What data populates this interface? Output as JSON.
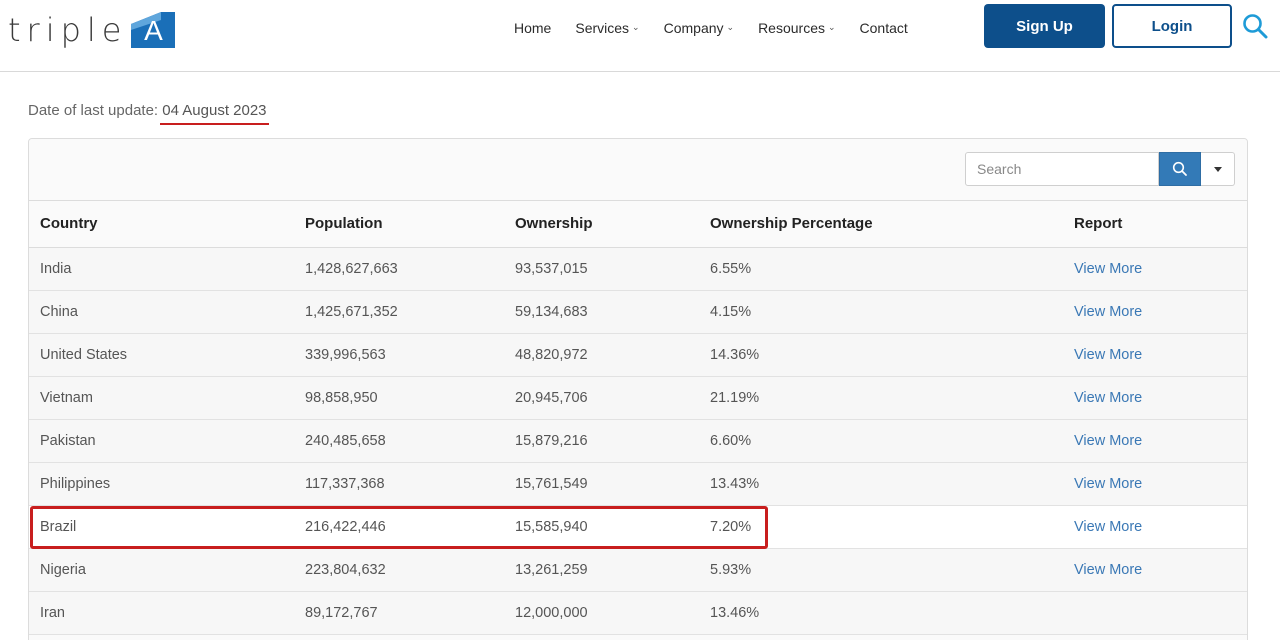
{
  "brand": {
    "logo_text": "triple",
    "logo_letter": "A",
    "accent": "#0d4f8b",
    "mark_color": "#1a6fb8"
  },
  "nav": {
    "items": [
      {
        "label": "Home",
        "has_dropdown": false
      },
      {
        "label": "Services",
        "has_dropdown": true
      },
      {
        "label": "Company",
        "has_dropdown": true
      },
      {
        "label": "Resources",
        "has_dropdown": true
      },
      {
        "label": "Contact",
        "has_dropdown": false
      }
    ],
    "signup_label": "Sign Up",
    "login_label": "Login",
    "search_icon": "search-icon"
  },
  "update": {
    "label": "Date of last update:",
    "date": "04 August 2023"
  },
  "table_search": {
    "placeholder": "Search"
  },
  "table": {
    "headers": [
      "Country",
      "Population",
      "Ownership",
      "Ownership Percentage",
      "Report"
    ],
    "rows": [
      {
        "country": "India",
        "population": "1,428,627,663",
        "ownership": "93,537,015",
        "percentage": "6.55%",
        "report": "View More"
      },
      {
        "country": "China",
        "population": "1,425,671,352",
        "ownership": "59,134,683",
        "percentage": "4.15%",
        "report": "View More"
      },
      {
        "country": "United States",
        "population": "339,996,563",
        "ownership": "48,820,972",
        "percentage": "14.36%",
        "report": "View More"
      },
      {
        "country": "Vietnam",
        "population": "98,858,950",
        "ownership": "20,945,706",
        "percentage": "21.19%",
        "report": "View More"
      },
      {
        "country": "Pakistan",
        "population": "240,485,658",
        "ownership": "15,879,216",
        "percentage": "6.60%",
        "report": "View More"
      },
      {
        "country": "Philippines",
        "population": "117,337,368",
        "ownership": "15,761,549",
        "percentage": "13.43%",
        "report": "View More"
      },
      {
        "country": "Brazil",
        "population": "216,422,446",
        "ownership": "15,585,940",
        "percentage": "7.20%",
        "report": "View More"
      },
      {
        "country": "Nigeria",
        "population": "223,804,632",
        "ownership": "13,261,259",
        "percentage": "5.93%",
        "report": "View More"
      },
      {
        "country": "Iran",
        "population": "89,172,767",
        "ownership": "12,000,000",
        "percentage": "13.46%",
        "report": ""
      }
    ],
    "highlighted_row": "Brazil",
    "highlight_color": "#c81e1e",
    "link_color": "#3a78b5"
  }
}
